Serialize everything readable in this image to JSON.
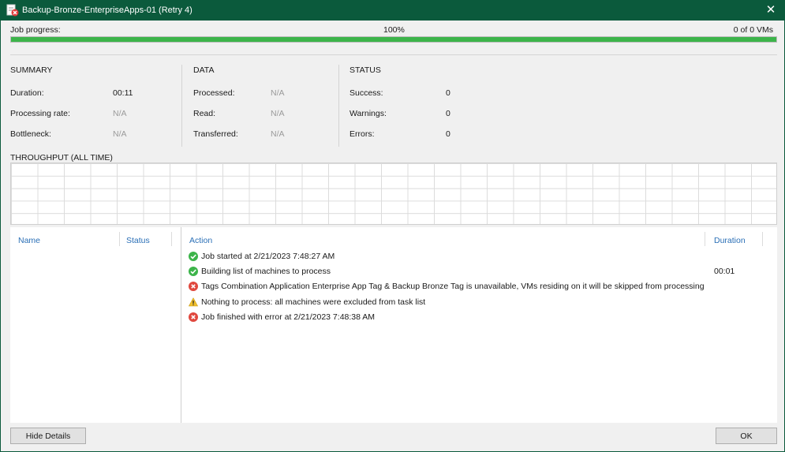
{
  "window": {
    "title": "Backup-Bronze-EnterpriseApps-01 (Retry 4)",
    "close_glyph": "✕",
    "accent": "#0b5a3c"
  },
  "progress": {
    "label": "Job progress:",
    "percent_text": "100%",
    "percent_value": 100,
    "vm_count": "0 of 0 VMs",
    "fill_color": "#3cb44a"
  },
  "summary": {
    "heading": "SUMMARY",
    "rows": [
      {
        "label": "Duration:",
        "value": "00:11",
        "na": false
      },
      {
        "label": "Processing rate:",
        "value": "N/A",
        "na": true
      },
      {
        "label": "Bottleneck:",
        "value": "N/A",
        "na": true
      }
    ]
  },
  "data": {
    "heading": "DATA",
    "rows": [
      {
        "label": "Processed:",
        "value": "N/A"
      },
      {
        "label": "Read:",
        "value": "N/A"
      },
      {
        "label": "Transferred:",
        "value": "N/A"
      }
    ]
  },
  "status": {
    "heading": "STATUS",
    "rows": [
      {
        "label": "Success:",
        "value": "0"
      },
      {
        "label": "Warnings:",
        "value": "0"
      },
      {
        "label": "Errors:",
        "value": "0"
      }
    ]
  },
  "throughput": {
    "label": "THROUGHPUT (ALL TIME)"
  },
  "vm_list": {
    "columns": {
      "name": "Name",
      "status": "Status"
    }
  },
  "log": {
    "columns": {
      "action": "Action",
      "duration": "Duration"
    },
    "entries": [
      {
        "icon": "success-icon",
        "text": "Job started at 2/21/2023 7:48:27 AM",
        "duration": ""
      },
      {
        "icon": "success-icon",
        "text": "Building list of machines to process",
        "duration": "00:01"
      },
      {
        "icon": "error-icon",
        "text": "Tags Combination Application Enterprise App Tag & Backup Bronze Tag is unavailable, VMs residing on it will be skipped from processing",
        "duration": ""
      },
      {
        "icon": "warning-icon",
        "text": "Nothing to process: all machines were excluded from task list",
        "duration": ""
      },
      {
        "icon": "error-icon",
        "text": "Job finished with error at 2/21/2023 7:48:38 AM",
        "duration": ""
      }
    ]
  },
  "buttons": {
    "hide_details": "Hide Details",
    "ok": "OK"
  }
}
